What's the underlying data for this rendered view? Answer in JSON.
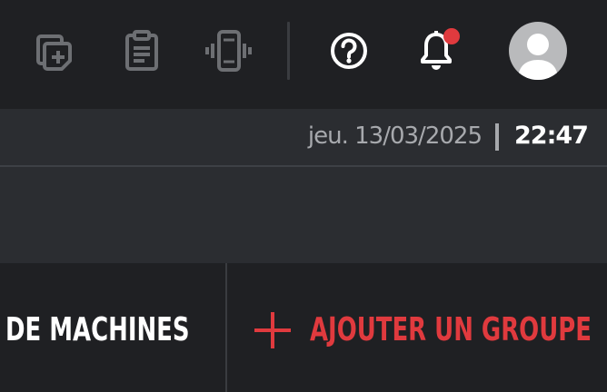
{
  "header": {
    "icons": [
      "add-document-icon",
      "clipboard-icon",
      "vibrate-phone-icon",
      "help-icon",
      "bell-icon",
      "avatar-icon"
    ],
    "notification_dot_color": "#e03a3e"
  },
  "datebar": {
    "date": "jeu. 13/03/2025",
    "time": "22:47"
  },
  "footer": {
    "machines_label": "DE MACHINES",
    "add_group_label": "AJOUTER UN GROUPE"
  },
  "colors": {
    "accent": "#e03a3e",
    "background": "#1f2023",
    "panel": "#2b2d31"
  }
}
